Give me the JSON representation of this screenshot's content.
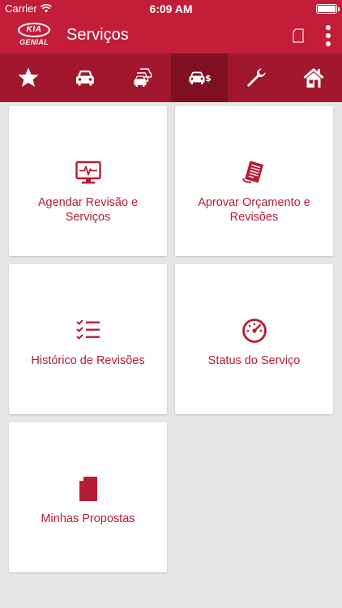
{
  "status_bar": {
    "carrier": "Carrier",
    "time": "6:09 AM"
  },
  "header": {
    "logo_top": "KIA",
    "logo_bottom": "GENIAL",
    "title": "Serviços"
  },
  "tabs": [
    {
      "icon": "star-icon",
      "active": false
    },
    {
      "icon": "car-icon",
      "active": false
    },
    {
      "icon": "cars-stack-icon",
      "active": false
    },
    {
      "icon": "car-dollar-icon",
      "active": true
    },
    {
      "icon": "wrench-icon",
      "active": false
    },
    {
      "icon": "home-icon",
      "active": false
    }
  ],
  "cards": [
    {
      "label": "Agendar Revisão e Serviços",
      "icon": "monitor-pulse-icon"
    },
    {
      "label": "Aprovar Orçamento e Revisões",
      "icon": "receipt-icon"
    },
    {
      "label": "Histórico de Revisões",
      "icon": "checklist-icon"
    },
    {
      "label": "Status do Serviço",
      "icon": "speedometer-icon"
    },
    {
      "label": "Minhas Propostas",
      "icon": "document-icon"
    }
  ],
  "colors": {
    "brand": "#c21e3a",
    "tabbar": "#a1182e",
    "tab_active": "#7e1022",
    "card_text": "#b71c35",
    "background": "#e6e6e6"
  }
}
